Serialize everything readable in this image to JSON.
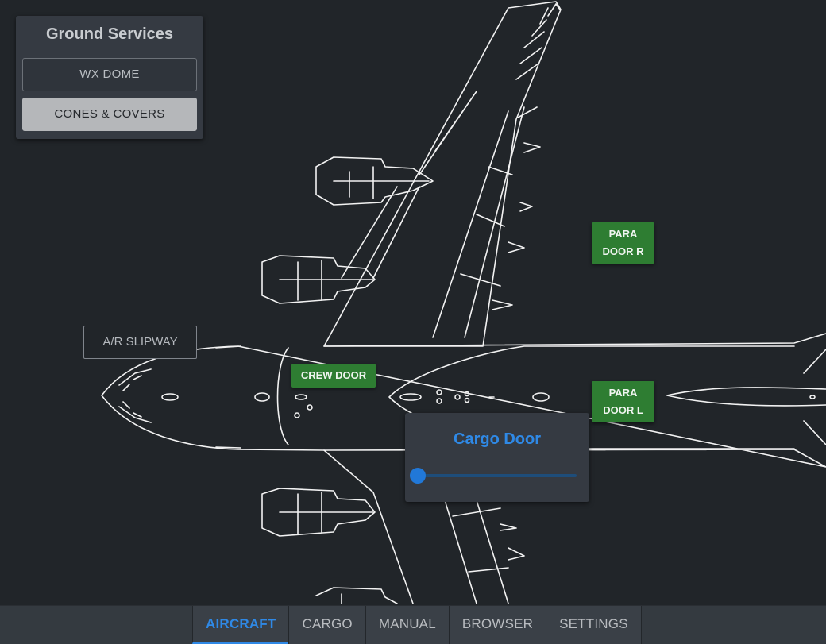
{
  "ground_services": {
    "title": "Ground Services",
    "buttons": [
      {
        "label": "WX DOME"
      },
      {
        "label": "CONES & COVERS"
      }
    ]
  },
  "aircraft_controls": {
    "ar_slipway": "A/R SLIPWAY",
    "crew_door": "CREW DOOR",
    "para_door_r": [
      "PARA",
      "DOOR R"
    ],
    "para_door_l": [
      "PARA",
      "DOOR L"
    ]
  },
  "cargo_door": {
    "title": "Cargo Door",
    "slider_value": 0.0
  },
  "tabs": [
    {
      "label": "AIRCRAFT",
      "active": true
    },
    {
      "label": "CARGO",
      "active": false
    },
    {
      "label": "MANUAL",
      "active": false
    },
    {
      "label": "BROWSER",
      "active": false
    },
    {
      "label": "SETTINGS",
      "active": false
    }
  ],
  "colors": {
    "background": "#212529",
    "accent": "#2f89e6",
    "door_button": "#2e7d32",
    "panel": "#353a42"
  }
}
